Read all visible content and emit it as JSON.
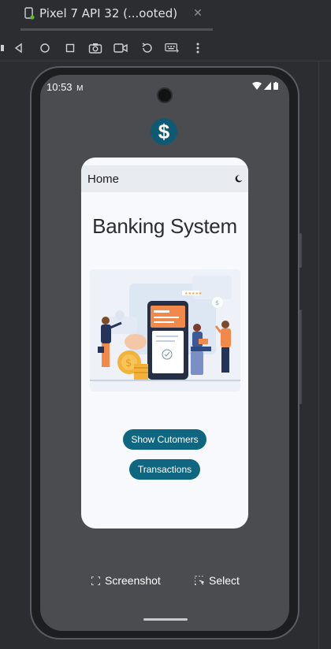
{
  "tab": {
    "title": "Pixel 7 API 32 (...ooted)",
    "close": "✕"
  },
  "toolbar": {
    "icons": [
      "back-icon",
      "home-icon",
      "overview-icon",
      "camera-icon",
      "video-icon",
      "rotate-icon",
      "keyboard-icon",
      "more-icon"
    ]
  },
  "status": {
    "time": "10:53",
    "notification_glyph": "M"
  },
  "app": {
    "icon_glyph": "$",
    "appbar_title": "Home",
    "heading": "Banking System",
    "buttons": {
      "show_customers": "Show Cutomers",
      "transactions": "Transactions"
    }
  },
  "emulator_actions": {
    "screenshot": "Screenshot",
    "select": "Select"
  },
  "colors": {
    "ide_bg": "#2b2d30",
    "phone_screen": "#4b4c50",
    "app_bg": "#f7f9fc",
    "appbar_bg": "#e8ecf0",
    "primary": "#0f6681",
    "icon_bg": "#0e5a73"
  }
}
